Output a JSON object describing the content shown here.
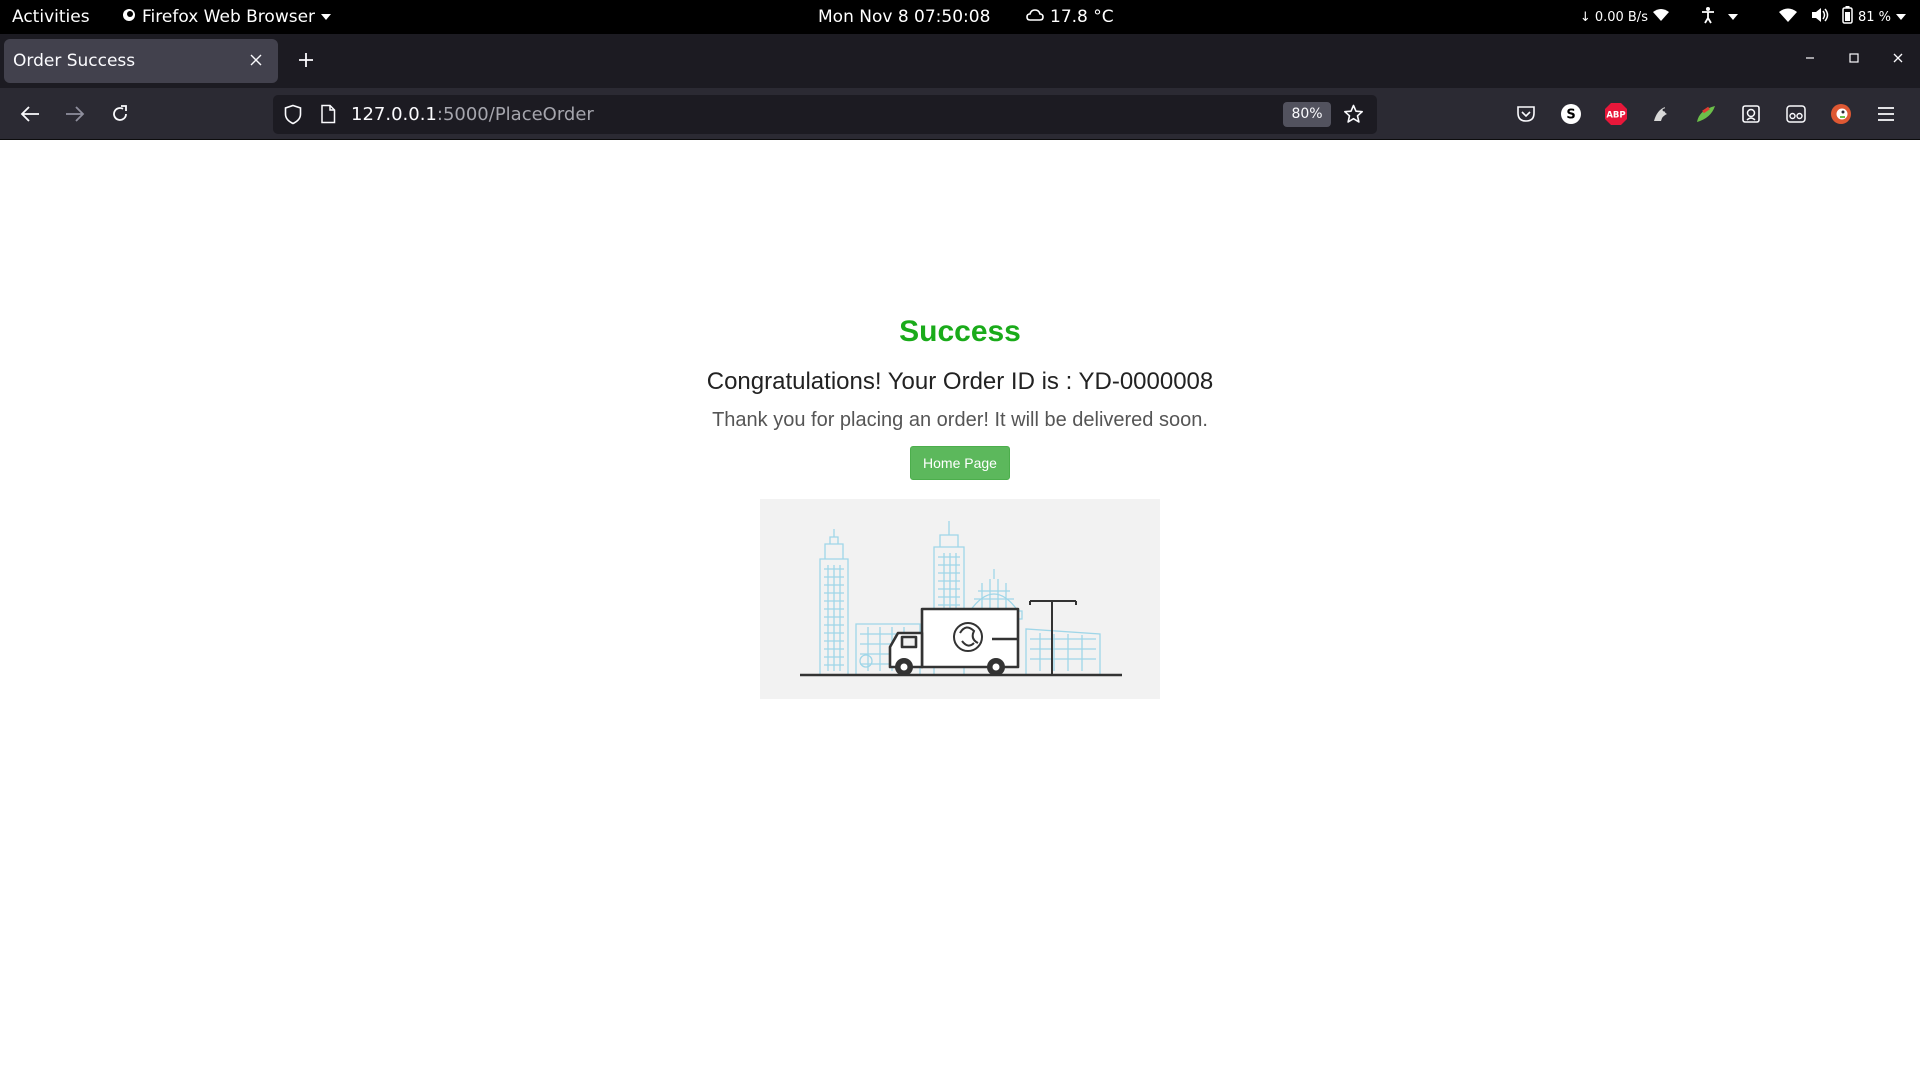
{
  "system_bar": {
    "activities": "Activities",
    "app_name": "Firefox Web Browser",
    "datetime": "Mon Nov 8  07:50:08",
    "temperature": "17.8 °C",
    "net_speed": "0.00 B/s",
    "battery": "81 %"
  },
  "browser": {
    "tab_title": "Order Success",
    "url_host": "127.0.0.1",
    "url_rest": ":5000/PlaceOrder",
    "zoom": "80%",
    "ext_abp_label": "ABP",
    "ext_s_label": "S"
  },
  "page": {
    "title": "Success",
    "congrats": "Congratulations! Your Order ID is : YD-0000008",
    "thanks": "Thank you for placing an order! It will be delivered soon.",
    "home_button": "Home Page"
  },
  "colors": {
    "success_green": "#1aab1a",
    "button_green": "#5cb85c",
    "illustration_bg": "#f2f2f2",
    "building_blue": "#9fd6e8",
    "truck_dark": "#333333"
  }
}
